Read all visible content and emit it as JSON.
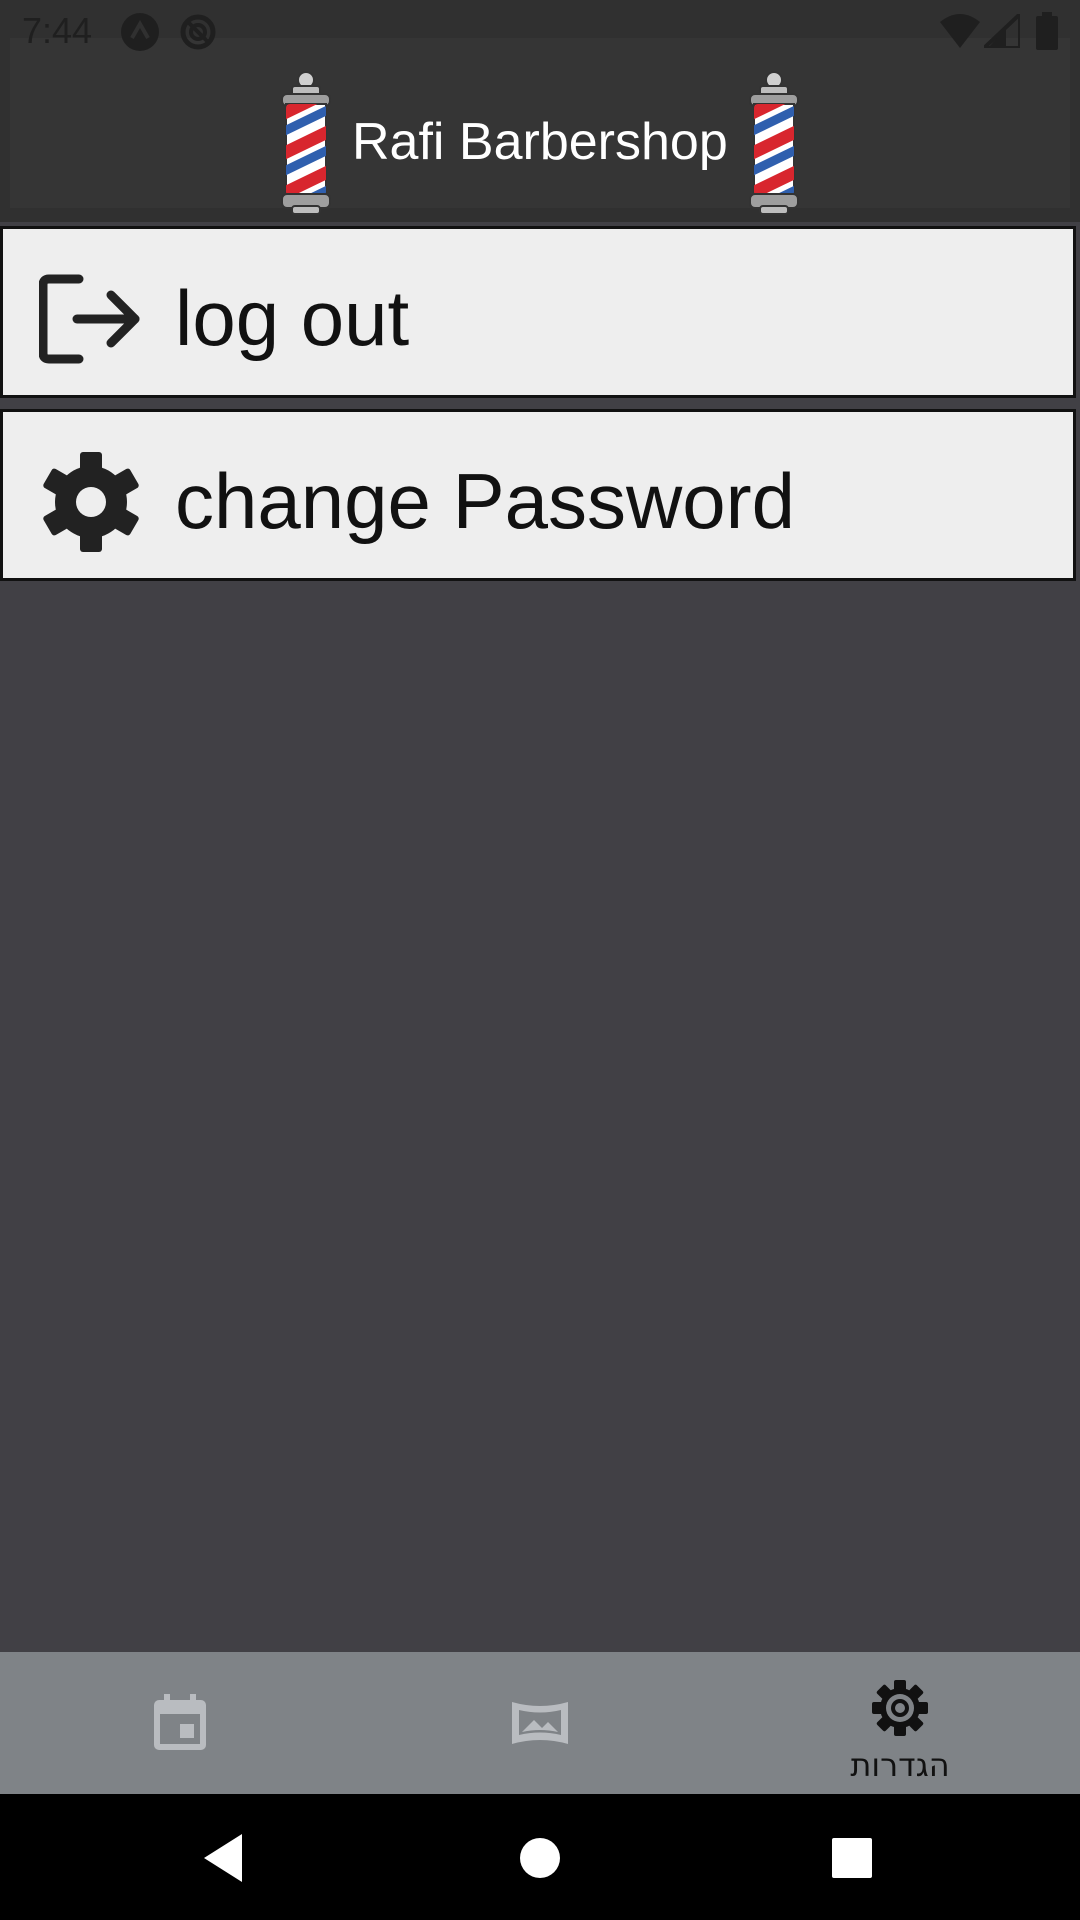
{
  "status_bar": {
    "time": "7:44",
    "icons": [
      "android-notification-icon",
      "sync-off-icon",
      "wifi-icon",
      "signal-icon",
      "battery-icon"
    ]
  },
  "header": {
    "title": "Rafi Barbershop",
    "logo_icons": [
      "barber-pole-icon",
      "barber-pole-icon"
    ]
  },
  "menu": {
    "items": [
      {
        "label": "log out",
        "icon": "logout-icon"
      },
      {
        "label": "change Password",
        "icon": "gear-icon"
      }
    ]
  },
  "bottom_nav": {
    "tabs": [
      {
        "icon": "calendar-icon",
        "label": "",
        "active": false
      },
      {
        "icon": "gallery-icon",
        "label": "",
        "active": false
      },
      {
        "icon": "settings-icon",
        "label": "הגדרות",
        "active": true
      }
    ]
  },
  "system_nav": {
    "buttons": [
      "back-icon",
      "home-icon",
      "recents-icon"
    ]
  },
  "colors": {
    "background": "#414045",
    "header": "#353535",
    "menu_item_bg": "#eeeeee",
    "bottom_nav_bg": "#7f8387",
    "inactive_icon": "#b9bcc0",
    "pole_red": "#d8262e",
    "pole_blue": "#2f5fae"
  }
}
